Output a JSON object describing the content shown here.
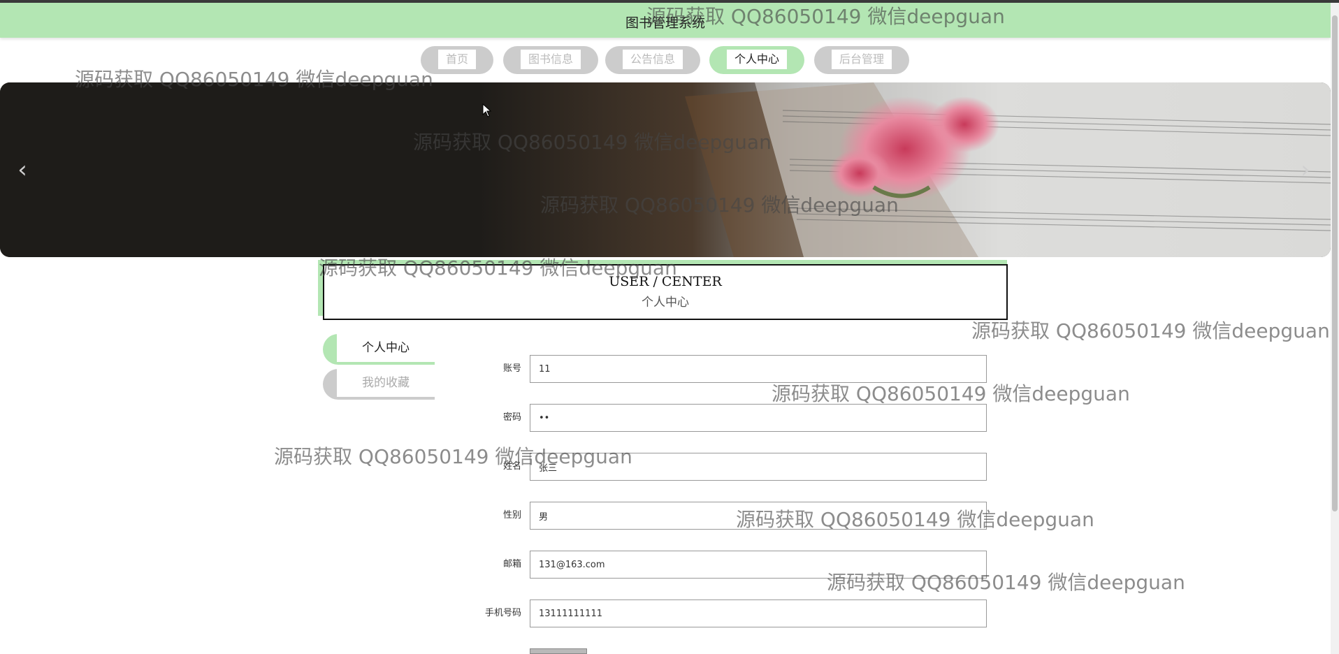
{
  "header": {
    "title": "图书管理系统"
  },
  "nav": {
    "items": [
      {
        "label": "首页",
        "active": false
      },
      {
        "label": "图书信息",
        "active": false
      },
      {
        "label": "公告信息",
        "active": false
      },
      {
        "label": "个人中心",
        "active": true
      },
      {
        "label": "后台管理",
        "active": false
      }
    ]
  },
  "banner": {
    "prev_icon": "chevron-left-icon",
    "next_icon": "chevron-right-icon",
    "prev_glyph": "‹",
    "next_glyph": "›"
  },
  "section": {
    "title_en": "USER / CENTER",
    "title_zh": "个人中心"
  },
  "sidebar": {
    "items": [
      {
        "label": "个人中心",
        "active": true
      },
      {
        "label": "我的收藏",
        "active": false
      }
    ]
  },
  "form": {
    "fields": [
      {
        "label": "账号",
        "value": "11"
      },
      {
        "label": "密码",
        "value": "••"
      },
      {
        "label": "姓名",
        "value": "张三"
      },
      {
        "label": "性别",
        "value": "男"
      },
      {
        "label": "邮箱",
        "value": "131@163.com"
      },
      {
        "label": "手机号码",
        "value": "13111111111"
      }
    ]
  },
  "watermark_text": "源码获取 QQ86050149 微信deepguan",
  "colors": {
    "accent": "#b3e6b3",
    "inactive": "#cccccc",
    "banner_dark": "#1e1c19"
  }
}
